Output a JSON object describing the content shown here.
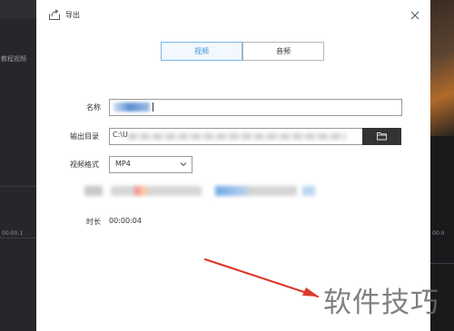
{
  "background": {
    "left_panel_label": "教程视频",
    "left_timestamp": "00:00:1",
    "right_timestamp": "00:0"
  },
  "dialog": {
    "title": "导出",
    "icons": {
      "title": "export-icon",
      "close": "close-icon",
      "browse": "folder-icon",
      "dropdown": "chevron-down-icon"
    },
    "tabs": [
      {
        "label": "视频",
        "selected": true
      },
      {
        "label": "音频",
        "selected": false
      }
    ],
    "fields": {
      "name_label": "名称",
      "output_dir_label": "输出目录",
      "output_dir_value": "C:\\U",
      "format_label": "视频格式",
      "format_value": "MP4",
      "duration_label": "时长",
      "duration_value": "00:00:04"
    }
  },
  "colors": {
    "accent": "#3e95d8",
    "browse_button": "#333333",
    "annotation_arrow": "#d93a2b"
  },
  "watermark": "软件技巧"
}
